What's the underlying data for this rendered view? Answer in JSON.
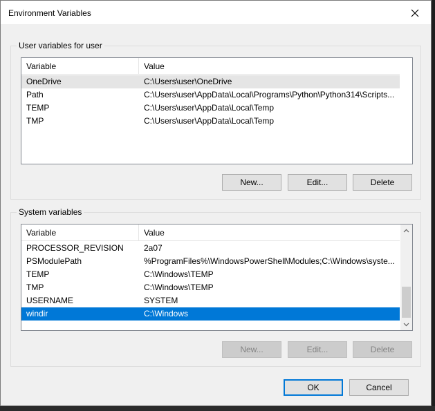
{
  "window": {
    "title": "Environment Variables"
  },
  "user_vars": {
    "group_label": "User variables for user",
    "headers": {
      "variable": "Variable",
      "value": "Value"
    },
    "rows": [
      {
        "variable": "OneDrive",
        "value": "C:\\Users\\user\\OneDrive"
      },
      {
        "variable": "Path",
        "value": "C:\\Users\\user\\AppData\\Local\\Programs\\Python\\Python314\\Scripts..."
      },
      {
        "variable": "TEMP",
        "value": "C:\\Users\\user\\AppData\\Local\\Temp"
      },
      {
        "variable": "TMP",
        "value": "C:\\Users\\user\\AppData\\Local\\Temp"
      }
    ],
    "buttons": {
      "new": "New...",
      "edit": "Edit...",
      "delete": "Delete"
    }
  },
  "system_vars": {
    "group_label": "System variables",
    "headers": {
      "variable": "Variable",
      "value": "Value"
    },
    "rows": [
      {
        "variable": "PROCESSOR_REVISION",
        "value": "2a07"
      },
      {
        "variable": "PSModulePath",
        "value": "%ProgramFiles%\\WindowsPowerShell\\Modules;C:\\Windows\\syste..."
      },
      {
        "variable": "TEMP",
        "value": "C:\\Windows\\TEMP"
      },
      {
        "variable": "TMP",
        "value": "C:\\Windows\\TEMP"
      },
      {
        "variable": "USERNAME",
        "value": "SYSTEM"
      },
      {
        "variable": "windir",
        "value": "C:\\Windows"
      }
    ],
    "selected_row": "windir",
    "buttons": {
      "new": "New...",
      "edit": "Edit...",
      "delete": "Delete"
    }
  },
  "footer": {
    "ok": "OK",
    "cancel": "Cancel"
  },
  "colors": {
    "selection": "#0078d7",
    "dialog_bg": "#f0f0f0"
  },
  "icons": {
    "close": "close-icon",
    "scroll_up": "chevron-up-icon",
    "scroll_down": "chevron-down-icon"
  }
}
